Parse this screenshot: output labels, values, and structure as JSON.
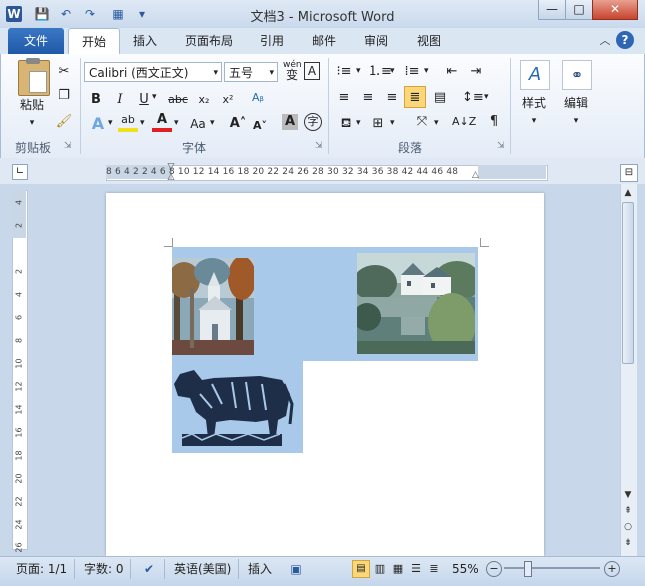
{
  "window": {
    "title": "文档3 - Microsoft Word",
    "quick_access": [
      "W",
      "💾",
      "↶",
      "↷",
      "▦",
      "▾"
    ],
    "controls": {
      "minimize": "—",
      "maximize": "□",
      "close": "✕"
    }
  },
  "tabs": [
    "文件",
    "开始",
    "插入",
    "页面布局",
    "引用",
    "邮件",
    "审阅",
    "视图"
  ],
  "ribbon": {
    "clipboard": {
      "paste_label": "粘贴",
      "group_label": "剪贴板"
    },
    "font": {
      "font_name": "Calibri (西文正文)",
      "font_size": "五号",
      "group_label": "字体",
      "wen_label": "wén"
    },
    "paragraph": {
      "group_label": "段落"
    },
    "styles": {
      "label": "样式"
    },
    "editing": {
      "label": "编辑"
    }
  },
  "ruler": {
    "horizontal_ticks": "8  6  4  2    2  4  6  8  10  12  14  16  18  20  22  24  26  28  30  32  34  36  38    42  44  46  48",
    "vertical_ticks": [
      "4",
      "2",
      "",
      "2",
      "4",
      "6",
      "8",
      "10",
      "12",
      "14",
      "16",
      "18",
      "20",
      "22",
      "24",
      "26"
    ]
  },
  "status": {
    "page": "页面: 1/1",
    "words": "字数: 0",
    "language": "英语(美国)",
    "mode": "插入",
    "zoom": "55%"
  },
  "colors": {
    "image_background": "#a9c9ea",
    "ribbon_accent": "#1f59a8"
  }
}
